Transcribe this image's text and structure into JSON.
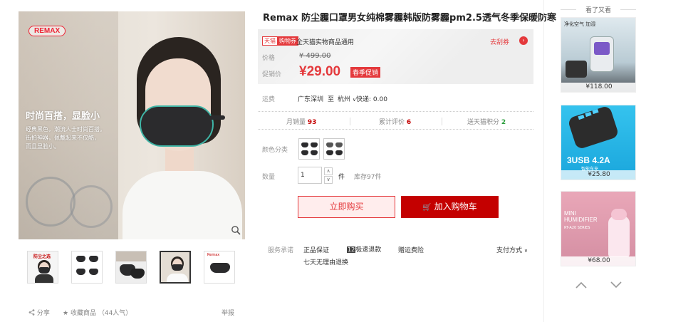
{
  "gallery": {
    "brand_logo": "REMAX",
    "promo_title": "时尚百搭，显脸小",
    "promo_lines": [
      "经典黑色，潮流人士时尚百搭。",
      "街拍神器，佩戴起来不仅酷，",
      "而且显脸小。"
    ],
    "icons": [
      "zoom-icon"
    ],
    "thumb_labels": [
      "防尘之选",
      "",
      "",
      "",
      "Remax"
    ],
    "active_thumb_index": 3
  },
  "actions": {
    "share_label": "分享",
    "favorite_label": "收藏商品",
    "popularity": "（44人气）",
    "report_label": "举报"
  },
  "product": {
    "title": "Remax 防尘霾口罩男女纯棉雾霾韩版防雾霾pm2.5透气冬季保暖防寒",
    "tag_tmall": "天猫",
    "tag_coupon": "购物券",
    "tmall_text": "全天猫实物商品通用",
    "coupon_link": "去刮券",
    "price_label": "价格",
    "old_price": "¥ 499.00",
    "promo_price_label": "促销价",
    "new_price": "¥29.00",
    "promo_tag": "春季促销",
    "shipping_label": "运费",
    "shipping_from": "广东深圳",
    "shipping_to_word": "至",
    "shipping_to": "杭州",
    "shipping_cost": "快递: 0.00",
    "stats": {
      "monthly_sales_label": "月销量",
      "monthly_sales": "93",
      "reviews_label": "累计评价",
      "reviews": "6",
      "points_label": "送天猫积分",
      "points": "2"
    },
    "color_label": "颜色分类",
    "quantity_label": "数量",
    "quantity_value": "1",
    "quantity_unit": "件",
    "stock": "库存97件",
    "buy_now": "立即购买",
    "add_to_cart": "加入购物车",
    "service_label": "服务承诺",
    "service_items": [
      "正品保证",
      "极速退款",
      "赠运费险"
    ],
    "service_badge": "12",
    "service_extra": "七天无理由退换",
    "payment_label": "支付方式"
  },
  "sidebar": {
    "title": "看了又看",
    "items": [
      {
        "banner": "净化空气 加湿",
        "price": "¥118.00"
      },
      {
        "banner": "3USB 4.2A",
        "subtitle": "智能车充",
        "price": "¥25.80"
      },
      {
        "banner": "MINI HUMIDIFIER",
        "subtitle": "RT-A20 SERIES",
        "price": "¥68.00"
      }
    ]
  },
  "colors": {
    "accent": "#e4393c",
    "cart_button": "#c40000",
    "price_box_bg": "#eeeeee",
    "mask_trim": "#3fb5a6"
  }
}
